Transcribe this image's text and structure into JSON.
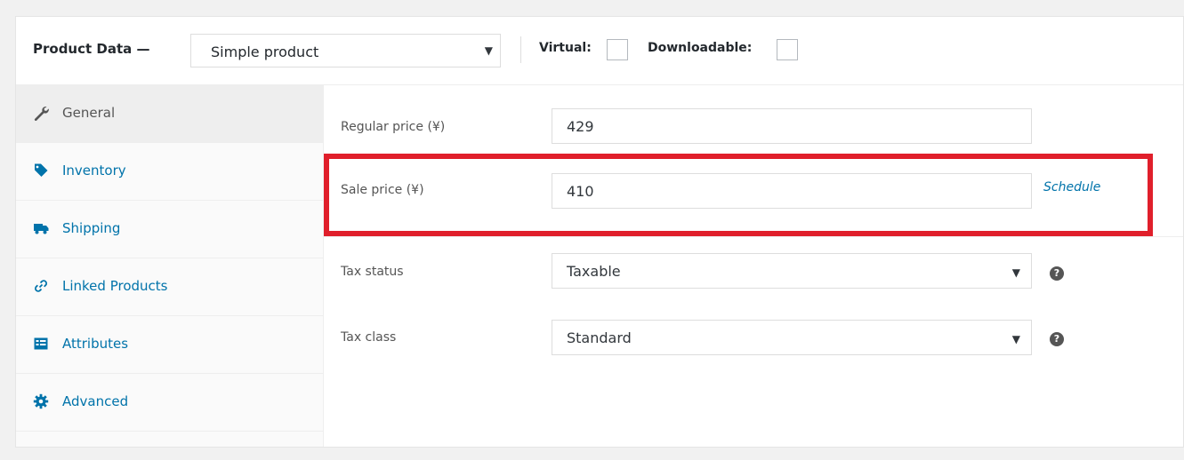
{
  "header": {
    "title": "Product Data —",
    "product_type": "Simple product",
    "virtual_label": "Virtual:",
    "downloadable_label": "Downloadable:"
  },
  "tabs": [
    {
      "label": "General",
      "icon": "wrench-icon"
    },
    {
      "label": "Inventory",
      "icon": "tag-icon"
    },
    {
      "label": "Shipping",
      "icon": "truck-icon"
    },
    {
      "label": "Linked Products",
      "icon": "link-icon"
    },
    {
      "label": "Attributes",
      "icon": "list-icon"
    },
    {
      "label": "Advanced",
      "icon": "gear-icon"
    }
  ],
  "general": {
    "regular_price_label": "Regular price (¥)",
    "regular_price_value": "429",
    "sale_price_label": "Sale price (¥)",
    "sale_price_value": "410",
    "schedule_link": "Schedule",
    "tax_status_label": "Tax status",
    "tax_status_value": "Taxable",
    "tax_class_label": "Tax class",
    "tax_class_value": "Standard",
    "help_glyph": "?"
  },
  "colors": {
    "link": "#0073aa",
    "highlight": "#e01f2b"
  }
}
